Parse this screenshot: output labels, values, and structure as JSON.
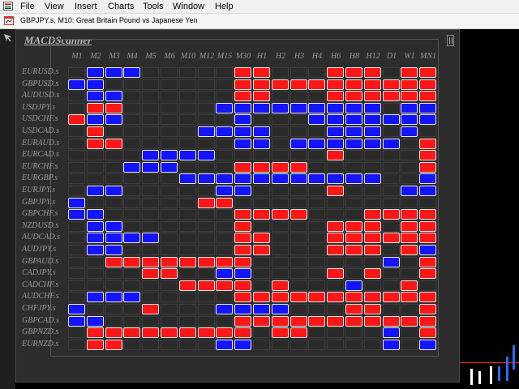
{
  "menu": {
    "items": [
      "File",
      "View",
      "Insert",
      "Charts",
      "Tools",
      "Window",
      "Help"
    ]
  },
  "chart_tab": {
    "title": "GBPJPY.s, M10:  Great Britain Pound vs Japanese Yen"
  },
  "panel": {
    "title": "MACDScanner"
  },
  "timeframes": [
    "M1",
    "M2",
    "M3",
    "M4",
    "M5",
    "M6",
    "M10",
    "M12",
    "M15",
    "M30",
    "H1",
    "H2",
    "H3",
    "H4",
    "H6",
    "H8",
    "H12",
    "D1",
    "W1",
    "MN1"
  ],
  "symbols": [
    "EURUSD.s",
    "GBPUSD.s",
    "AUDUSD.s",
    "USDJPY.s",
    "USDCHF.s",
    "USDCAD.s",
    "EURAUD.s",
    "EURCAD.s",
    "EURCHF.s",
    "EURGBP.s",
    "EURJPY.s",
    "GBPJPY.s",
    "GBPCHF.s",
    "NZDUSD.s",
    "AUDCAD.s",
    "AUDJPY.s",
    "GBPAUD.s",
    "CADJPY.s",
    "CADCHF.s",
    "AUDCHF.s",
    "CHFJPY.s",
    "GBPCAD.s",
    "GBPNZD.s",
    "EURNZD.s"
  ],
  "colors": {
    "up": "#ff1616",
    "down": "#1414ff",
    "neutral": "#2a2a2a"
  },
  "signal_legend": {
    "R": "red",
    "B": "blue",
    ".": "empty"
  },
  "signals": [
    ".BBB.....RR...RRR.RR",
    "BB.......RRRRRRRRRRR",
    ".BB......RR...RRRRRR",
    ".RR.....BBBBBBBBB.BB",
    "RBB......B...BBBBBBB",
    ".R.....BBBB...BBB.B.",
    ".RR......BB.BBBBBB.R",
    "....BBBB......R....R",
    "...BBB...RRRR......R",
    "......BBBBBBBBBBB..B",
    ".BB.....BB....R...BB",
    "B......RR...........",
    "BB.......RRRR...RRRR",
    ".BB......R....RRR.RR",
    ".BBBB....RR...RRRRRR",
    ".BB......RR...RRR.RB",
    "..RRRRRRRR.......B.R",
    "....RR..BB....R.R..R",
    "......RRRR.R...B..R.",
    ".BBB.....RRRRRRRRRRR",
    "B...R...BBBB...RR..R",
    "BB.......RRRRRRRRRRR",
    ".RRRRRRRRR.RR....B.R",
    ".RR.....BB.......B.B"
  ]
}
